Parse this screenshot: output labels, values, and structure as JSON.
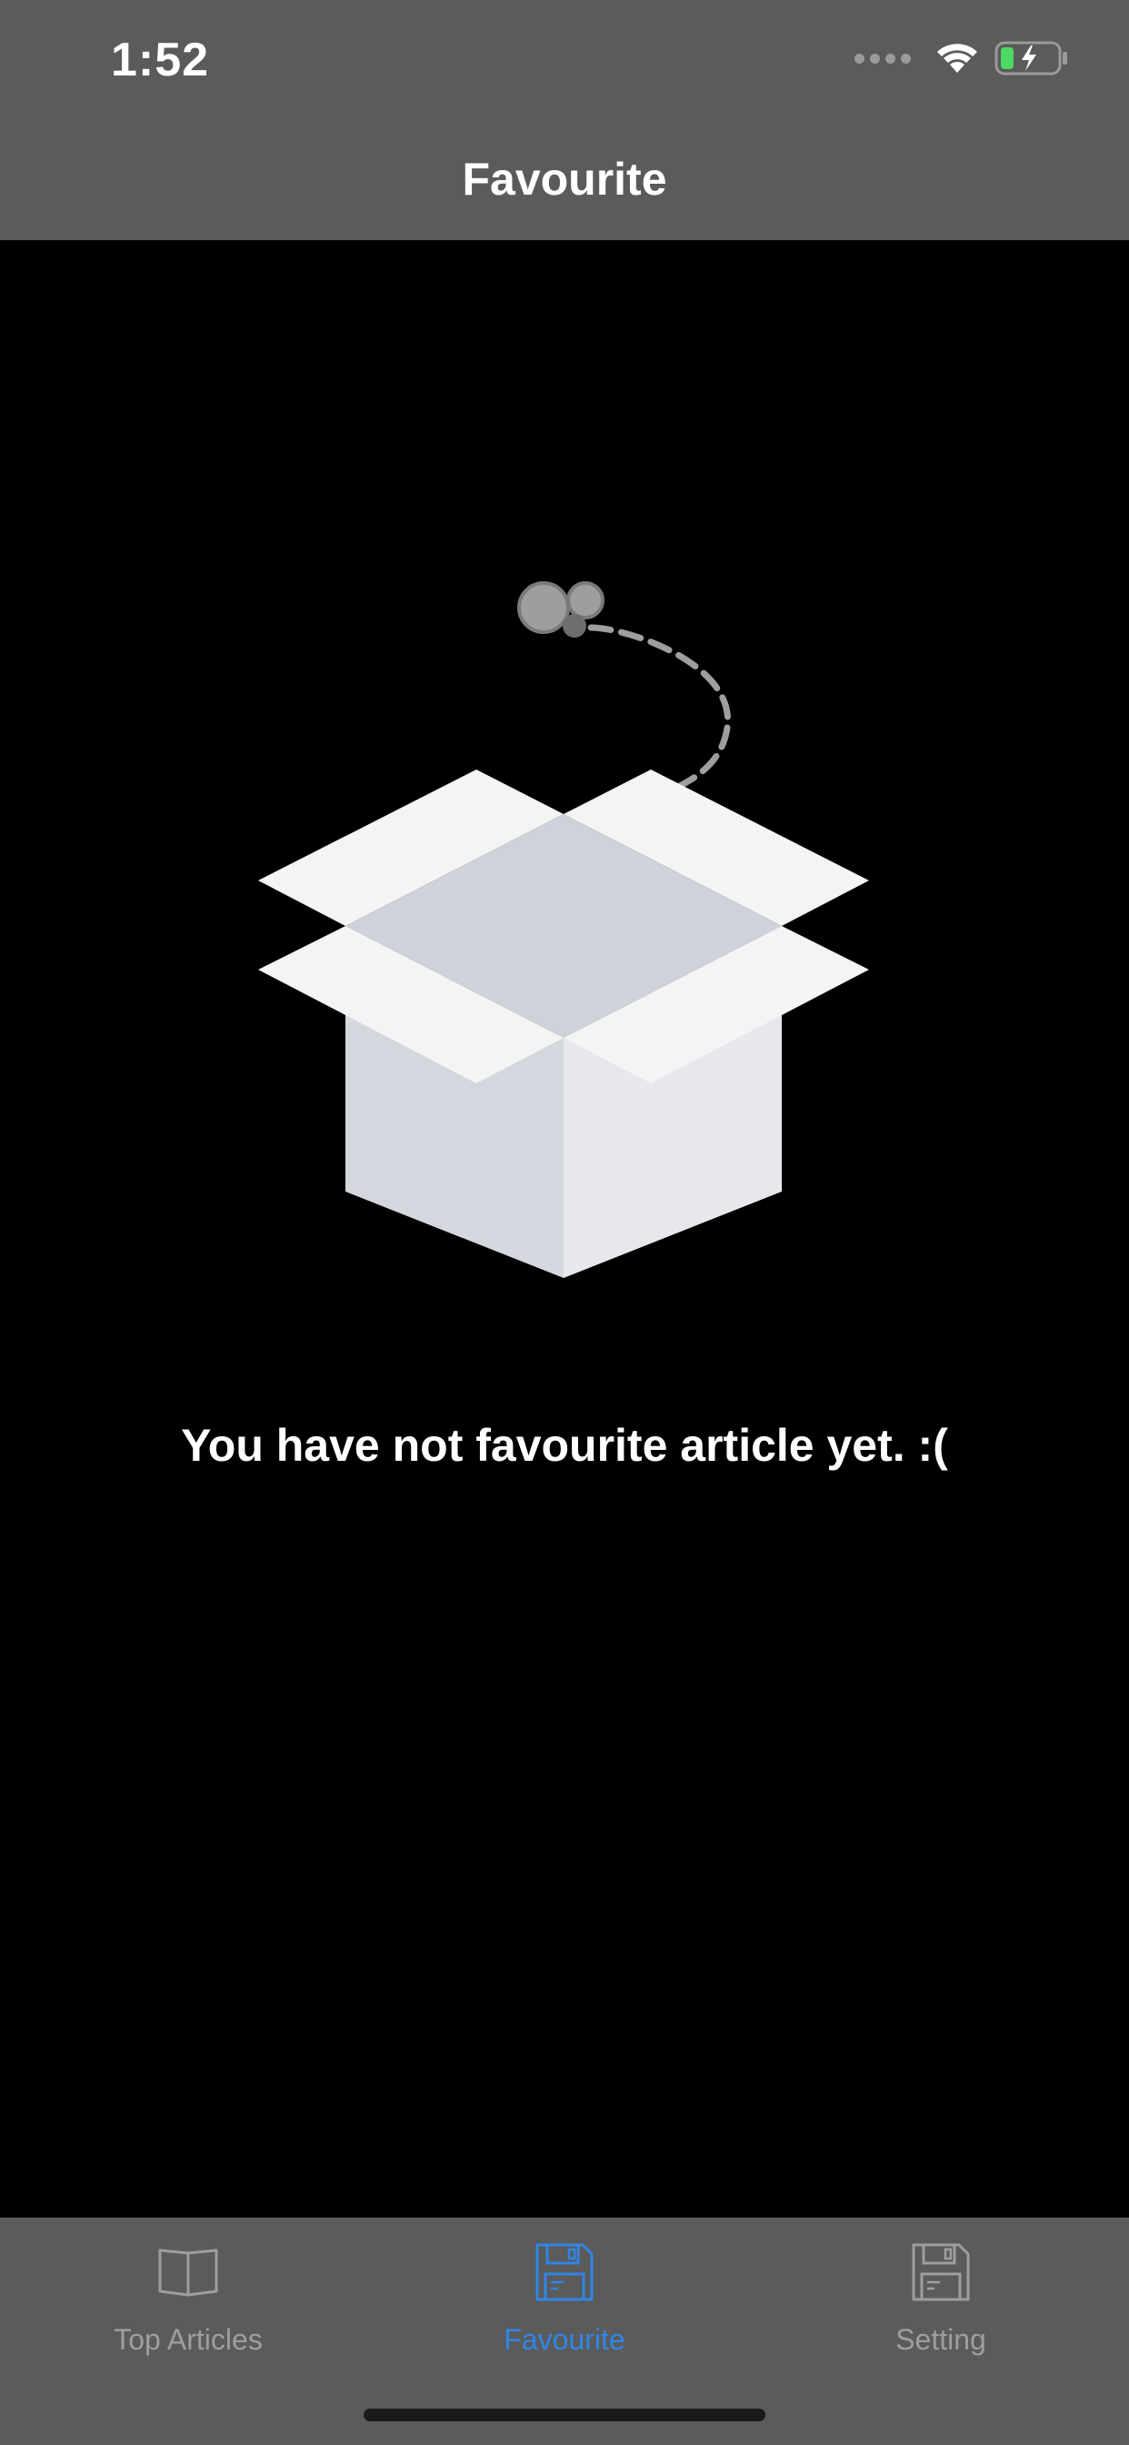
{
  "status_bar": {
    "time": "1:52",
    "icons": [
      "signal-icon",
      "wifi-icon",
      "battery-charging-icon"
    ]
  },
  "nav": {
    "title": "Favourite"
  },
  "empty_state": {
    "illustration": "empty-box-icon",
    "message": "You have not favourite article yet. :("
  },
  "tab_bar": {
    "tabs": [
      {
        "label": "Top Articles",
        "icon": "book-icon",
        "active": false
      },
      {
        "label": "Favourite",
        "icon": "floppy-disk-icon",
        "active": true
      },
      {
        "label": "Setting",
        "icon": "floppy-disk-icon",
        "active": false
      }
    ],
    "active_color": "#2f86e6",
    "inactive_color": "#9e9e9e"
  },
  "colors": {
    "bar_background": "#5b5b5b",
    "screen_background": "#000000"
  }
}
